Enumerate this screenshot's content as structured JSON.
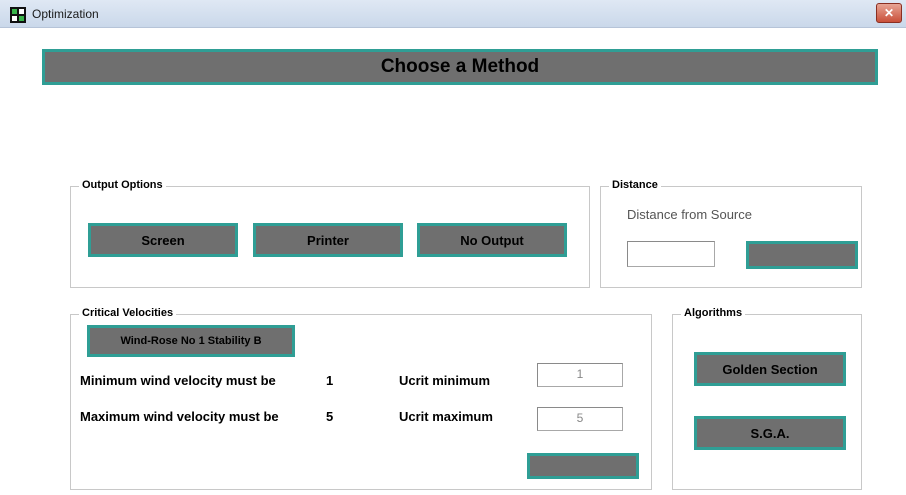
{
  "window": {
    "title": "Optimization",
    "close_glyph": "✕",
    "icon": "app-icon"
  },
  "heading": "Choose a Method",
  "output_options": {
    "legend": "Output Options",
    "buttons": [
      "Screen",
      "Printer",
      "No Output"
    ]
  },
  "distance": {
    "legend": "Distance",
    "label": "Distance from Source",
    "input_value": "",
    "button_label": ""
  },
  "critical_velocities": {
    "legend": "Critical Velocities",
    "windrose_button": "Wind-Rose No 1  Stability B",
    "min_text": "Minimum wind velocity must be",
    "min_value": "1",
    "max_text": "Maximum wind velocity must be",
    "max_value": "5",
    "ucrit_min_label": "Ucrit minimum",
    "ucrit_min_value": "1",
    "ucrit_max_label": "Ucrit maximum",
    "ucrit_max_value": "5",
    "apply_button": ""
  },
  "algorithms": {
    "legend": "Algorithms",
    "buttons": [
      "Golden Section",
      "S.G.A."
    ]
  },
  "colors": {
    "button_fill": "#6f6f6f",
    "button_border": "#2f9e95"
  }
}
